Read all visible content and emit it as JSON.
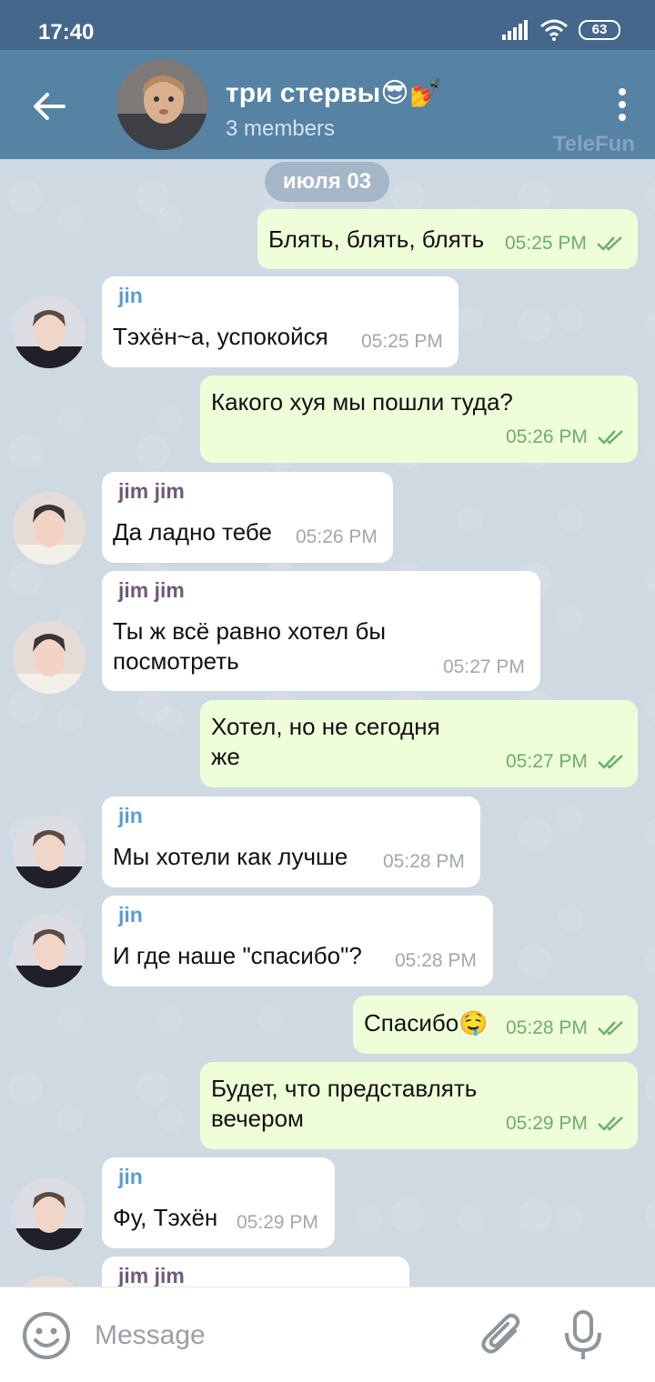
{
  "status_bar": {
    "time": "17:40",
    "battery": "63"
  },
  "header": {
    "title": "три стервы😎💅",
    "subtitle": "3 members",
    "watermark": "TeleFun"
  },
  "date_separator": "июля 03",
  "messages": [
    {
      "dir": "out",
      "text": "Блять, блять, блять",
      "time": "05:25 PM"
    },
    {
      "dir": "in",
      "sender": "jin",
      "text": "Тэхён~а, успокойся",
      "time": "05:25 PM"
    },
    {
      "dir": "out",
      "text": "Какого хуя мы пошли туда?",
      "time": "05:26 PM"
    },
    {
      "dir": "in",
      "sender": "jim jim",
      "text": "Да ладно тебе",
      "time": "05:26 PM"
    },
    {
      "dir": "in",
      "sender": "jim jim",
      "text_lines": [
        "Ты ж всё равно хотел бы",
        "посмотреть"
      ],
      "time": "05:27 PM"
    },
    {
      "dir": "out",
      "text_lines": [
        "Хотел, но не сегодня",
        "же"
      ],
      "time": "05:27 PM"
    },
    {
      "dir": "in",
      "sender": "jin",
      "text": "Мы хотели как лучше",
      "time": "05:28 PM"
    },
    {
      "dir": "in",
      "sender": "jin",
      "text": "И где наше \"спасибо\"?",
      "time": "05:28 PM"
    },
    {
      "dir": "out",
      "text": "Спасибо🤤",
      "time": "05:28 PM"
    },
    {
      "dir": "out",
      "text_lines": [
        "Будет, что представлять",
        "вечером"
      ],
      "time": "05:29 PM"
    },
    {
      "dir": "in",
      "sender": "jin",
      "text": "Фу, Тэхён",
      "time": "05:29 PM"
    },
    {
      "dir": "in",
      "sender": "jim jim",
      "text": "",
      "time": ""
    }
  ],
  "input": {
    "placeholder": "Message"
  },
  "colors": {
    "appbar": "#5682a3",
    "status_bar": "#45678c",
    "outgoing_bubble": "#eefed9",
    "incoming_bubble": "#ffffff",
    "sender_jin": "#5b9bd5",
    "sender_jimjim": "#6e5a78",
    "check": "#6fae6b"
  },
  "icons": [
    "back-arrow-icon",
    "more-vert-icon",
    "emoji-icon",
    "attach-icon",
    "mic-icon",
    "double-check-icon",
    "signal-icon",
    "wifi-icon",
    "battery-icon"
  ]
}
